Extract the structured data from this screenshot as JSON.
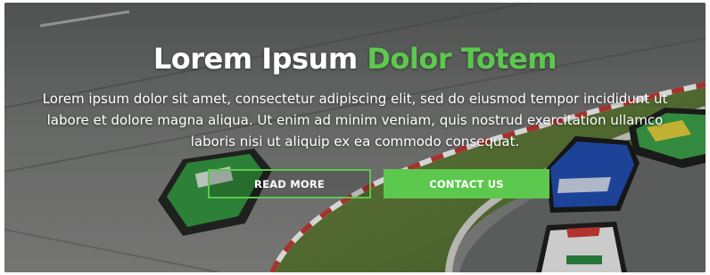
{
  "hero": {
    "title_main": "Lorem Ipsum ",
    "title_accent": "Dolor Totem",
    "body_lines": [
      "Lorem ipsum dolor sit amet, consectetur adipiscing elit, sed do eiusmod tempor incididunt ut",
      "labore et dolore magna aliqua. Ut enim ad minim veniam, quis nostrud exercitation ullamco",
      "laboris nisi ut aliquip ex ea commodo consequat."
    ],
    "read_more_label": "READ MORE",
    "contact_label": "CONTACT US"
  },
  "colors": {
    "accent": "#5cc84e",
    "text": "#ffffff",
    "track": "#6f716f",
    "grass": "#5f7a3a"
  }
}
